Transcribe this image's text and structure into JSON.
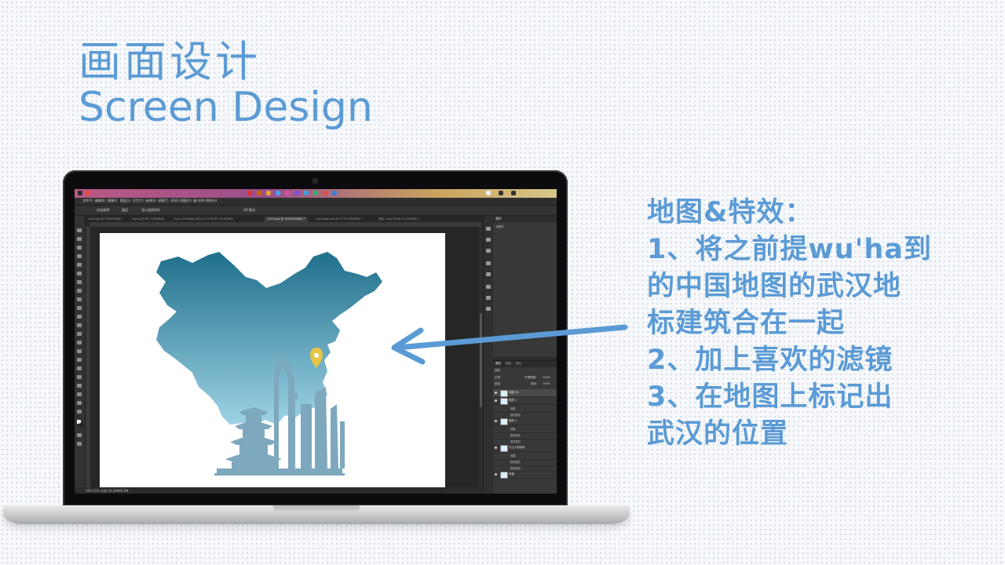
{
  "slide": {
    "title_cn": "画面设计",
    "title_en": "Screen Design",
    "accent_color": "#5b9bd5"
  },
  "description": {
    "lines": [
      "地图&特效：",
      "1、将之前提wu'ha到",
      "的中国地图的武汉地",
      "标建筑合在一起",
      "2、加上喜欢的滤镜",
      "3、在地图上标记出",
      "武汉的位置"
    ]
  },
  "photoshop": {
    "menu": [
      "文件(F)",
      "编辑(E)",
      "图像(I)",
      "图层(L)",
      "文字(Y)",
      "选择(S)",
      "滤镜(T)",
      "3D(D)",
      "视图(V)",
      "窗口(W)",
      "帮助(H)"
    ],
    "options": {
      "auto_select": "自动选择：",
      "layer_dropdown": "图层",
      "show_transform": "显示变换控件",
      "mode_3d": "3D 模式："
    },
    "document_tabs": [
      {
        "label": "chart.jpg @ 50%(RGB/8)",
        "active": false
      },
      {
        "label": "hujing @ 66.7%(RGB/8)",
        "active": false
      },
      {
        "label": "fupu_20c4dbb_35202117 @ 66.7%(RGB/8)",
        "active": false
      },
      {
        "label": "2323.psd @ 100%(RGB/8) *",
        "active": true
      },
      {
        "label": "trackbook.psd @ 33.3% (RGB/8) *",
        "active": false
      },
      {
        "label": "背影 1.psd @ 66.7% (RGB/8) *",
        "active": false
      }
    ],
    "status": "100.25%   文档:30.2M/69.5M",
    "properties_panel": {
      "title": "属性",
      "subtitle": "无属性"
    },
    "layers_panel": {
      "tabs": [
        "图层",
        "通道",
        "路径"
      ],
      "kind_filter": "类型",
      "blend_mode": "正常",
      "opacity_label": "不透明度:",
      "opacity_value": "100%",
      "lock_label": "锁定:",
      "fill_label": "填充:",
      "fill_value": "100%",
      "layers": [
        {
          "name": "地图 28",
          "kind": "layer",
          "selected": true
        },
        {
          "name": "图层 1",
          "kind": "layer",
          "selected": false
        },
        {
          "name": "效果",
          "kind": "sub",
          "selected": false
        },
        {
          "name": "颜色叠加",
          "kind": "sub",
          "selected": false
        },
        {
          "name": "图层 2",
          "kind": "layer",
          "selected": false
        },
        {
          "name": "效果",
          "kind": "sub",
          "selected": false
        },
        {
          "name": "颜色叠加",
          "kind": "sub",
          "selected": false
        },
        {
          "name": "渐变叠加",
          "kind": "sub",
          "selected": false
        },
        {
          "name": "长江大桥剪影",
          "kind": "layer",
          "selected": false
        },
        {
          "name": "效果",
          "kind": "sub",
          "selected": false
        },
        {
          "name": "颜色叠加",
          "kind": "sub",
          "selected": false
        },
        {
          "name": "渐变叠加",
          "kind": "sub",
          "selected": false
        },
        {
          "name": "背景",
          "kind": "layer",
          "selected": false
        }
      ]
    },
    "canvas": {
      "map_color_top": "#1f6f8b",
      "map_color_bottom": "#9fd3e6",
      "marker_color": "#e8c547",
      "skyline_color": "#7ea8bd"
    }
  }
}
